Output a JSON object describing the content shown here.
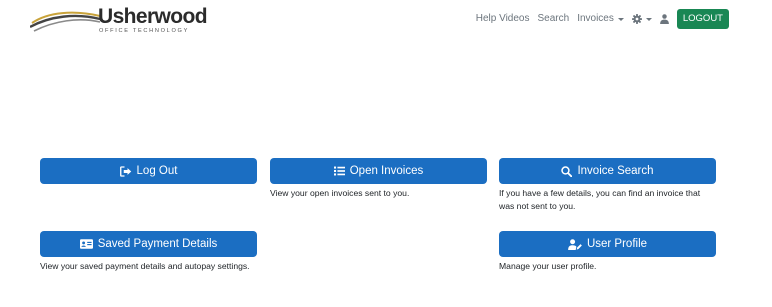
{
  "brand": {
    "name": "Usherwood",
    "tagline": "OFFICE TECHNOLOGY"
  },
  "nav": {
    "help_videos": "Help Videos",
    "search": "Search",
    "invoices": "Invoices",
    "settings_icon": "gear-icon",
    "user_icon": "user-icon",
    "logout": "LOGOUT"
  },
  "cards": {
    "logout": {
      "label": "Log Out",
      "icon": "sign-out-icon",
      "description": ""
    },
    "open_invoices": {
      "label": "Open Invoices",
      "icon": "list-icon",
      "description": "View your open invoices sent to you."
    },
    "invoice_search": {
      "label": "Invoice Search",
      "icon": "search-icon",
      "description": "If you have a few details, you can find an invoice that was not sent to you."
    },
    "saved_payment": {
      "label": "Saved Payment Details",
      "icon": "id-card-icon",
      "description": "View your saved payment details and autopay settings."
    },
    "user_profile": {
      "label": "User Profile",
      "icon": "user-edit-icon",
      "description": "Manage your user profile."
    }
  },
  "colors": {
    "primary": "#1b6ec2",
    "logout_green": "#198754",
    "nav_text": "#6c757d"
  }
}
